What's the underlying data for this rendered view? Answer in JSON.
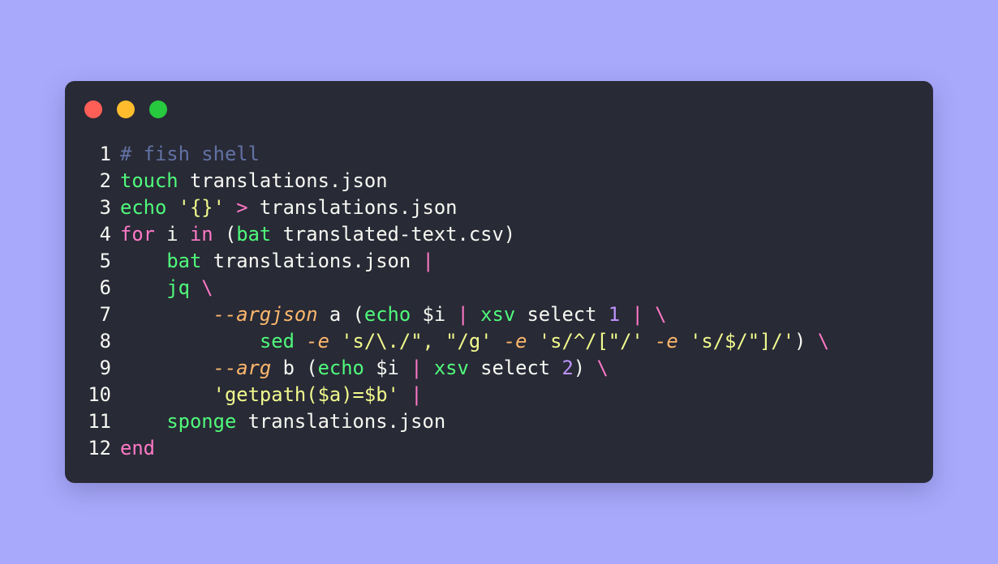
{
  "colors": {
    "background": "#a9a9fc",
    "window": "#282a36",
    "close_dot": "#ff5f56",
    "minimize_dot": "#ffbd2e",
    "maximize_dot": "#27c93f"
  },
  "code": {
    "lines": [
      {
        "number": "1",
        "tokens": [
          {
            "t": "# fish shell",
            "c": "comment"
          }
        ]
      },
      {
        "number": "2",
        "tokens": [
          {
            "t": "touch",
            "c": "cmd"
          },
          {
            "t": " translations.json",
            "c": "plain"
          }
        ]
      },
      {
        "number": "3",
        "tokens": [
          {
            "t": "echo",
            "c": "cmd"
          },
          {
            "t": " ",
            "c": "plain"
          },
          {
            "t": "'{}'",
            "c": "str"
          },
          {
            "t": " ",
            "c": "plain"
          },
          {
            "t": ">",
            "c": "op"
          },
          {
            "t": " translations.json",
            "c": "plain"
          }
        ]
      },
      {
        "number": "4",
        "tokens": [
          {
            "t": "for",
            "c": "kw"
          },
          {
            "t": " i ",
            "c": "plain"
          },
          {
            "t": "in",
            "c": "kw"
          },
          {
            "t": " (",
            "c": "plain"
          },
          {
            "t": "bat",
            "c": "cmd"
          },
          {
            "t": " translated-text.csv)",
            "c": "plain"
          }
        ]
      },
      {
        "number": "5",
        "tokens": [
          {
            "t": "    ",
            "c": "plain"
          },
          {
            "t": "bat",
            "c": "cmd"
          },
          {
            "t": " translations.json ",
            "c": "plain"
          },
          {
            "t": "|",
            "c": "op"
          }
        ]
      },
      {
        "number": "6",
        "tokens": [
          {
            "t": "    ",
            "c": "plain"
          },
          {
            "t": "jq",
            "c": "cmd"
          },
          {
            "t": " ",
            "c": "plain"
          },
          {
            "t": "\\",
            "c": "op"
          }
        ]
      },
      {
        "number": "7",
        "tokens": [
          {
            "t": "        ",
            "c": "plain"
          },
          {
            "t": "--argjson",
            "c": "flag"
          },
          {
            "t": " a (",
            "c": "plain"
          },
          {
            "t": "echo",
            "c": "cmd"
          },
          {
            "t": " $i ",
            "c": "plain"
          },
          {
            "t": "|",
            "c": "op"
          },
          {
            "t": " ",
            "c": "plain"
          },
          {
            "t": "xsv",
            "c": "cmd"
          },
          {
            "t": " select ",
            "c": "plain"
          },
          {
            "t": "1",
            "c": "num"
          },
          {
            "t": " ",
            "c": "plain"
          },
          {
            "t": "|",
            "c": "op"
          },
          {
            "t": " ",
            "c": "plain"
          },
          {
            "t": "\\",
            "c": "op"
          }
        ]
      },
      {
        "number": "8",
        "tokens": [
          {
            "t": "            ",
            "c": "plain"
          },
          {
            "t": "sed",
            "c": "cmd"
          },
          {
            "t": " ",
            "c": "plain"
          },
          {
            "t": "-e",
            "c": "flag"
          },
          {
            "t": " ",
            "c": "plain"
          },
          {
            "t": "'s/\\./\", \"/g'",
            "c": "str"
          },
          {
            "t": " ",
            "c": "plain"
          },
          {
            "t": "-e",
            "c": "flag"
          },
          {
            "t": " ",
            "c": "plain"
          },
          {
            "t": "'s/^/[\"/'",
            "c": "str"
          },
          {
            "t": " ",
            "c": "plain"
          },
          {
            "t": "-e",
            "c": "flag"
          },
          {
            "t": " ",
            "c": "plain"
          },
          {
            "t": "'s/$/\"]/'",
            "c": "str"
          },
          {
            "t": ") ",
            "c": "plain"
          },
          {
            "t": "\\",
            "c": "op"
          }
        ]
      },
      {
        "number": "9",
        "tokens": [
          {
            "t": "        ",
            "c": "plain"
          },
          {
            "t": "--arg",
            "c": "flag"
          },
          {
            "t": " b (",
            "c": "plain"
          },
          {
            "t": "echo",
            "c": "cmd"
          },
          {
            "t": " $i ",
            "c": "plain"
          },
          {
            "t": "|",
            "c": "op"
          },
          {
            "t": " ",
            "c": "plain"
          },
          {
            "t": "xsv",
            "c": "cmd"
          },
          {
            "t": " select ",
            "c": "plain"
          },
          {
            "t": "2",
            "c": "num"
          },
          {
            "t": ") ",
            "c": "plain"
          },
          {
            "t": "\\",
            "c": "op"
          }
        ]
      },
      {
        "number": "10",
        "tokens": [
          {
            "t": "        ",
            "c": "plain"
          },
          {
            "t": "'getpath($a)=$b'",
            "c": "str"
          },
          {
            "t": " ",
            "c": "plain"
          },
          {
            "t": "|",
            "c": "op"
          }
        ]
      },
      {
        "number": "11",
        "tokens": [
          {
            "t": "    ",
            "c": "plain"
          },
          {
            "t": "sponge",
            "c": "cmd"
          },
          {
            "t": " translations.json",
            "c": "plain"
          }
        ]
      },
      {
        "number": "12",
        "tokens": [
          {
            "t": "end",
            "c": "kw"
          }
        ]
      }
    ]
  }
}
